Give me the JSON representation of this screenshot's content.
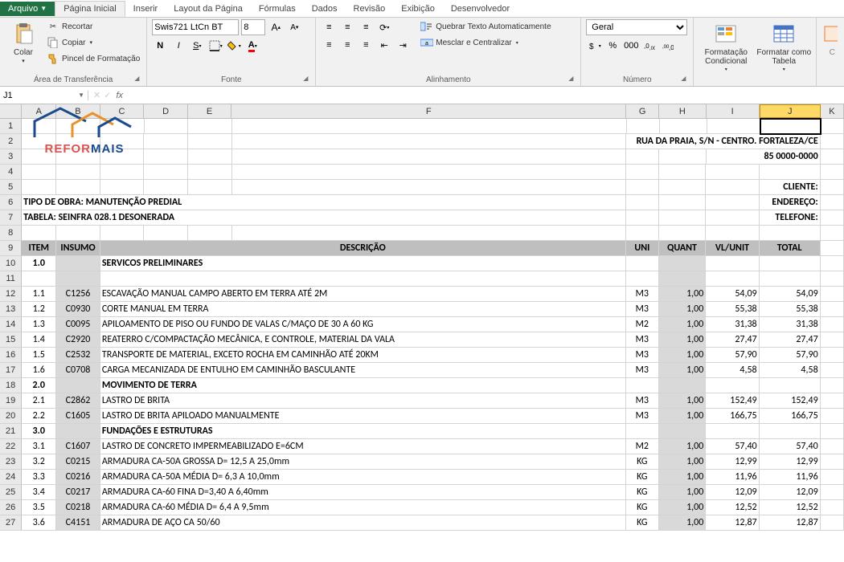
{
  "tabs": {
    "file": "Arquivo",
    "home": "Página Inicial",
    "insert": "Inserir",
    "layout": "Layout da Página",
    "formulas": "Fórmulas",
    "data": "Dados",
    "review": "Revisão",
    "view": "Exibição",
    "dev": "Desenvolvedor"
  },
  "ribbon": {
    "paste": "Colar",
    "cut": "Recortar",
    "copy": "Copiar",
    "painter": "Pincel de Formatação",
    "clipboard_group": "Área de Transferência",
    "font_name": "Swis721 LtCn BT",
    "font_size": "8",
    "font_group": "Fonte",
    "wrap": "Quebrar Texto Automaticamente",
    "merge": "Mesclar e Centralizar",
    "align_group": "Alinhamento",
    "number_format": "Geral",
    "number_group": "Número",
    "cond": "Formatação Condicional",
    "table": "Formatar como Tabela"
  },
  "formula_bar": {
    "name_box": "J1",
    "fx": "fx",
    "value": ""
  },
  "columns": [
    "A",
    "B",
    "C",
    "D",
    "E",
    "F",
    "G",
    "H",
    "I",
    "J",
    "K"
  ],
  "header_info": {
    "address": "RUA DA PRAIA, S/N - CENTRO. FORTALEZA/CE",
    "phone": "85 0000-0000",
    "cliente": "CLIENTE:",
    "endereco": "ENDEREÇO:",
    "telefone": "TELEFONE:",
    "tipo": "TIPO DE OBRA: MANUTENÇÃO PREDIAL",
    "tabela": "TABELA: SEINFRA 028.1 DESONERADA"
  },
  "table_headers": {
    "item": "ITEM",
    "insumo": "INSUMO",
    "desc": "DESCRIÇÃO",
    "uni": "UNI",
    "quant": "QUANT",
    "vlunit": "VL/UNIT",
    "total": "TOTAL"
  },
  "sections": {
    "s1": {
      "num": "1.0",
      "title": "SERVICOS PRELIMINARES"
    },
    "s2": {
      "num": "2.0",
      "title": "MOVIMENTO DE TERRA"
    },
    "s3": {
      "num": "3.0",
      "title": "FUNDAÇÕES E ESTRUTURAS"
    }
  },
  "rows": [
    {
      "n": "12",
      "item": "1.1",
      "ins": "C1256",
      "desc": "ESCAVAÇÃO MANUAL CAMPO ABERTO EM TERRA ATÉ 2M",
      "uni": "M3",
      "q": "1,00",
      "vu": "54,09",
      "tot": "54,09"
    },
    {
      "n": "13",
      "item": "1.2",
      "ins": "C0930",
      "desc": "CORTE MANUAL EM TERRA",
      "uni": "M3",
      "q": "1,00",
      "vu": "55,38",
      "tot": "55,38"
    },
    {
      "n": "14",
      "item": "1.3",
      "ins": "C0095",
      "desc": "APILOAMENTO DE PISO OU FUNDO DE VALAS C/MAÇO DE 30 A 60 KG",
      "uni": "M2",
      "q": "1,00",
      "vu": "31,38",
      "tot": "31,38"
    },
    {
      "n": "15",
      "item": "1.4",
      "ins": "C2920",
      "desc": "REATERRO C/COMPACTAÇÃO MECÂNICA, E CONTROLE, MATERIAL DA VALA",
      "uni": "M3",
      "q": "1,00",
      "vu": "27,47",
      "tot": "27,47"
    },
    {
      "n": "16",
      "item": "1.5",
      "ins": "C2532",
      "desc": "TRANSPORTE DE MATERIAL, EXCETO ROCHA EM CAMINHÃO ATÉ 20KM",
      "uni": "M3",
      "q": "1,00",
      "vu": "57,90",
      "tot": "57,90"
    },
    {
      "n": "17",
      "item": "1.6",
      "ins": "C0708",
      "desc": "CARGA MECANIZADA DE ENTULHO EM CAMINHÃO BASCULANTE",
      "uni": "M3",
      "q": "1,00",
      "vu": "4,58",
      "tot": "4,58"
    },
    {
      "n": "19",
      "item": "2.1",
      "ins": "C2862",
      "desc": "LASTRO DE BRITA",
      "uni": "M3",
      "q": "1,00",
      "vu": "152,49",
      "tot": "152,49"
    },
    {
      "n": "20",
      "item": "2.2",
      "ins": "C1605",
      "desc": "LASTRO DE BRITA  APILOADO MANUALMENTE",
      "uni": "M3",
      "q": "1,00",
      "vu": "166,75",
      "tot": "166,75"
    },
    {
      "n": "22",
      "item": "3.1",
      "ins": "C1607",
      "desc": "LASTRO DE CONCRETO IMPERMEABILIZADO E=6CM",
      "uni": "M2",
      "q": "1,00",
      "vu": "57,40",
      "tot": "57,40"
    },
    {
      "n": "23",
      "item": "3.2",
      "ins": "C0215",
      "desc": "ARMADURA CA-50A GROSSA D= 12,5 A 25,0mm",
      "uni": "KG",
      "q": "1,00",
      "vu": "12,99",
      "tot": "12,99"
    },
    {
      "n": "24",
      "item": "3.3",
      "ins": "C0216",
      "desc": "ARMADURA CA-50A MÉDIA D= 6,3 A 10,0mm",
      "uni": "KG",
      "q": "1,00",
      "vu": "11,96",
      "tot": "11,96"
    },
    {
      "n": "25",
      "item": "3.4",
      "ins": "C0217",
      "desc": "ARMADURA CA-60 FINA D=3,40 A 6,40mm",
      "uni": "KG",
      "q": "1,00",
      "vu": "12,09",
      "tot": "12,09"
    },
    {
      "n": "26",
      "item": "3.5",
      "ins": "C0218",
      "desc": "ARMADURA CA-60 MÉDIA D= 6,4 A 9,5mm",
      "uni": "KG",
      "q": "1,00",
      "vu": "12,52",
      "tot": "12,52"
    },
    {
      "n": "27",
      "item": "3.6",
      "ins": "C4151",
      "desc": "ARMADURA DE AÇO CA 50/60",
      "uni": "KG",
      "q": "1,00",
      "vu": "12,87",
      "tot": "12,87"
    }
  ],
  "logo": {
    "text": "REFORMAIS"
  }
}
